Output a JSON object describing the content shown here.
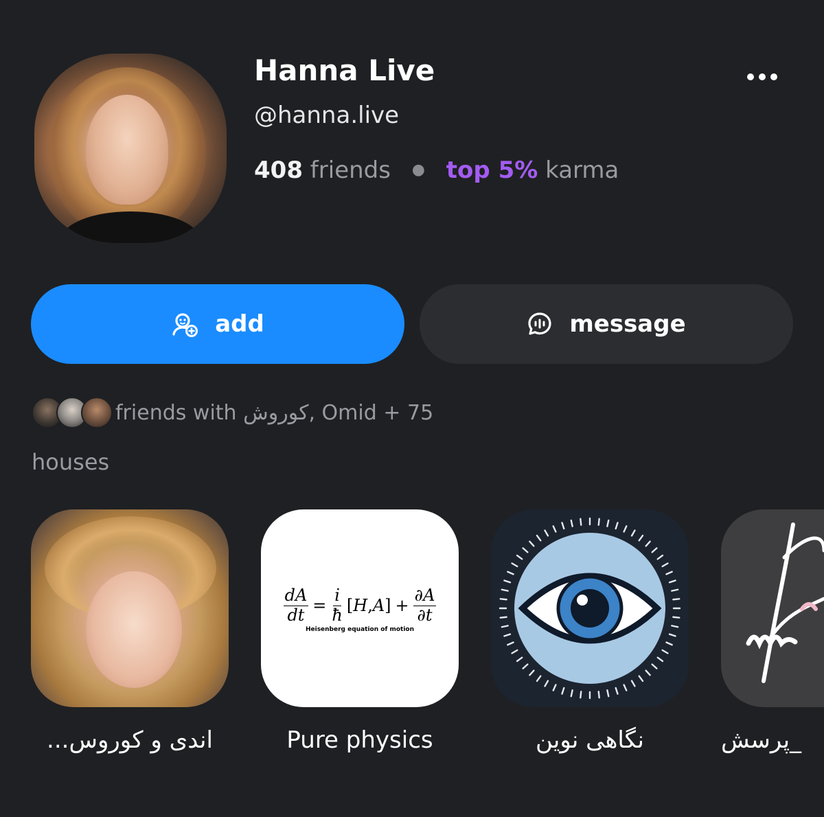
{
  "profile": {
    "name": "Hanna Live",
    "handle": "@hanna.live",
    "friends_count": "408",
    "friends_label": "friends",
    "karma_top": "top 5%",
    "karma_label": "karma"
  },
  "actions": {
    "add_label": "add",
    "message_label": "message"
  },
  "mutuals": {
    "text": "friends with کوروش, Omid + 75"
  },
  "houses": {
    "label": "houses",
    "items": [
      {
        "name": "اندی و کوروس..."
      },
      {
        "name": "Pure physics"
      },
      {
        "name": "نگاهی نوین"
      },
      {
        "name": "_پرسش"
      }
    ],
    "physics_tile": {
      "caption": "Heisenberg equation of motion"
    }
  },
  "colors": {
    "background": "#1f2023",
    "accent_blue": "#1a8cff",
    "karma_purple": "#a35cf2",
    "secondary_button": "#2c2d31",
    "muted_text": "#9a9ba0"
  }
}
